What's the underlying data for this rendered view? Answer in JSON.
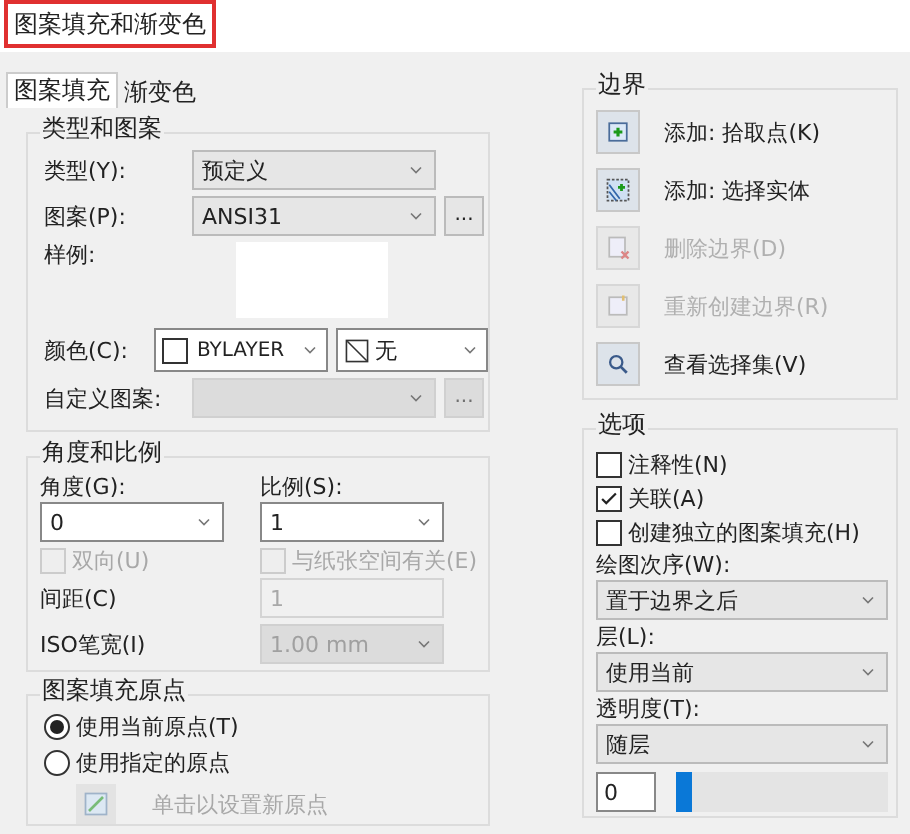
{
  "window": {
    "title": "图案填充和渐变色"
  },
  "tabs": [
    {
      "label": "图案填充",
      "selected": true
    },
    {
      "label": "渐变色",
      "selected": false
    }
  ],
  "type_and_pattern": {
    "title": "类型和图案",
    "type": {
      "label": "类型(Y):",
      "value": "预定义"
    },
    "pattern": {
      "label": "图案(P):",
      "value": "ANSI31",
      "browse": "..."
    },
    "swatch": {
      "label": "样例:"
    },
    "color": {
      "label": "颜色(C):",
      "value": "BYLAYER",
      "background": "无"
    },
    "custom_pattern": {
      "label": "自定义图案:",
      "disabled": true,
      "browse": "..."
    }
  },
  "angle_scale": {
    "title": "角度和比例",
    "angle": {
      "label": "角度(G):",
      "value": "0"
    },
    "scale": {
      "label": "比例(S):",
      "value": "1"
    },
    "double": {
      "label": "双向(U)",
      "checked": false,
      "disabled": true
    },
    "relative_paper": {
      "label": "与纸张空间有关(E)",
      "checked": false,
      "disabled": true
    },
    "spacing": {
      "label": "间距(C)",
      "value": "1",
      "disabled": true
    },
    "iso_pen_width": {
      "label": "ISO笔宽(I)",
      "value": "1.00 mm",
      "disabled": true
    }
  },
  "origin": {
    "title": "图案填充原点",
    "options": [
      {
        "label": "使用当前原点(T)",
        "selected": true
      },
      {
        "label": "使用指定的原点",
        "selected": false
      }
    ],
    "set_origin": {
      "label": "单击以设置新原点",
      "disabled": true
    }
  },
  "boundaries": {
    "title": "边界",
    "actions": [
      {
        "kind": "pick",
        "label": "添加: 拾取点(K)",
        "disabled": false
      },
      {
        "kind": "select",
        "label": "添加: 选择实体",
        "disabled": false
      },
      {
        "kind": "remove",
        "label": "删除边界(D)",
        "disabled": true
      },
      {
        "kind": "recreate",
        "label": "重新创建边界(R)",
        "disabled": true
      },
      {
        "kind": "view",
        "label": "查看选择集(V)",
        "disabled": false
      }
    ]
  },
  "options": {
    "title": "选项",
    "checkboxes": [
      {
        "label": "注释性(N)",
        "checked": false
      },
      {
        "label": "关联(A)",
        "checked": true
      },
      {
        "label": "创建独立的图案填充(H)",
        "checked": false
      }
    ],
    "draw_order": {
      "label": "绘图次序(W):",
      "value": "置于边界之后"
    },
    "layer": {
      "label": "层(L):",
      "value": "使用当前"
    },
    "transparency": {
      "label": "透明度(T):",
      "value": "随层",
      "amount": "0",
      "level": 0
    }
  }
}
